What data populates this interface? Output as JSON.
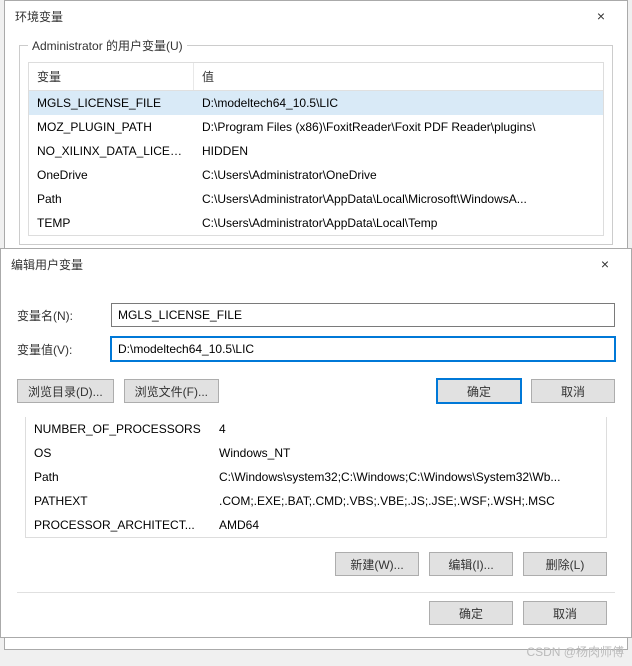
{
  "env_window": {
    "title": "环境变量",
    "close": "×",
    "user_group_title": "Administrator 的用户变量(U)",
    "columns": {
      "var": "变量",
      "val": "值"
    },
    "user_vars": [
      {
        "name": "MGLS_LICENSE_FILE",
        "value": "D:\\modeltech64_10.5\\LIC"
      },
      {
        "name": "MOZ_PLUGIN_PATH",
        "value": "D:\\Program Files (x86)\\FoxitReader\\Foxit PDF Reader\\plugins\\"
      },
      {
        "name": "NO_XILINX_DATA_LICENSE",
        "value": "HIDDEN"
      },
      {
        "name": "OneDrive",
        "value": "C:\\Users\\Administrator\\OneDrive"
      },
      {
        "name": "Path",
        "value": "C:\\Users\\Administrator\\AppData\\Local\\Microsoft\\WindowsA..."
      },
      {
        "name": "TEMP",
        "value": "C:\\Users\\Administrator\\AppData\\Local\\Temp"
      }
    ],
    "sys_vars": [
      {
        "name": "NUMBER_OF_PROCESSORS",
        "value": "4"
      },
      {
        "name": "OS",
        "value": "Windows_NT"
      },
      {
        "name": "Path",
        "value": "C:\\Windows\\system32;C:\\Windows;C:\\Windows\\System32\\Wb..."
      },
      {
        "name": "PATHEXT",
        "value": ".COM;.EXE;.BAT;.CMD;.VBS;.VBE;.JS;.JSE;.WSF;.WSH;.MSC"
      },
      {
        "name": "PROCESSOR_ARCHITECT...",
        "value": "AMD64"
      }
    ],
    "buttons": {
      "new": "新建(W)...",
      "edit": "编辑(I)...",
      "delete": "删除(L)",
      "ok": "确定",
      "cancel": "取消"
    }
  },
  "edit_window": {
    "title": "编辑用户变量",
    "close": "×",
    "name_label": "变量名(N):",
    "name_value": "MGLS_LICENSE_FILE",
    "value_label": "变量值(V):",
    "value_value": "D:\\modeltech64_10.5\\LIC",
    "buttons": {
      "browse_dir": "浏览目录(D)...",
      "browse_file": "浏览文件(F)...",
      "ok": "确定",
      "cancel": "取消"
    }
  },
  "watermark": "CSDN @杨肉师傅"
}
